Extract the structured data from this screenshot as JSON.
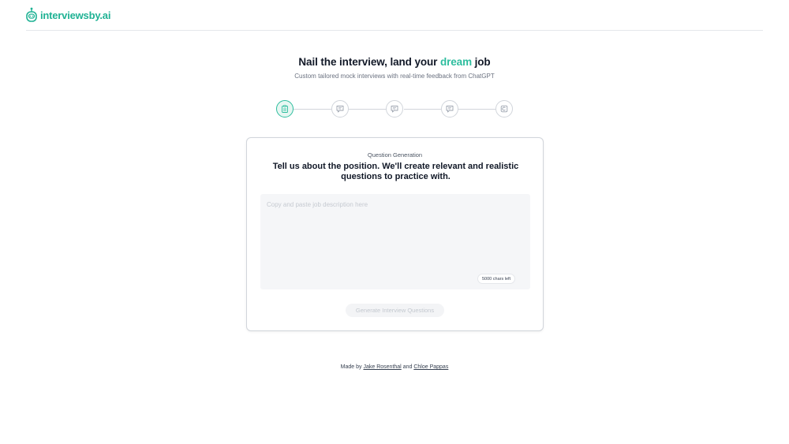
{
  "brand": {
    "name": "interviewsby.ai",
    "color": "#1fb294"
  },
  "hero": {
    "title_prefix": "Nail the interview, land your ",
    "title_accent": "dream",
    "title_suffix": " job",
    "accent_color": "#2dbd9e",
    "subtitle": "Custom tailored mock interviews with real-time feedback from ChatGPT"
  },
  "stepper": {
    "active_index": 0,
    "steps": [
      {
        "icon": "clipboard-icon"
      },
      {
        "icon": "chat-icon"
      },
      {
        "icon": "chat-icon"
      },
      {
        "icon": "chat-icon"
      },
      {
        "icon": "copyright-icon"
      }
    ]
  },
  "card": {
    "step_label": "Question Generation",
    "title": "Tell us about the position. We'll create relevant and realistic questions to practice with.",
    "textarea": {
      "value": "",
      "placeholder": "Copy and paste job description here"
    },
    "chars_left": "5000 chars left",
    "generate_label": "Generate Interview Questions"
  },
  "footer": {
    "made_by": "Made by",
    "author1": "Jake Rosenthal",
    "and": "and",
    "author2": "Chloe Pappas"
  }
}
